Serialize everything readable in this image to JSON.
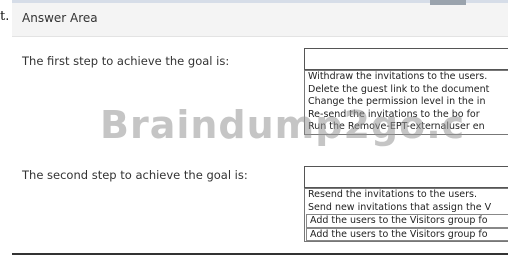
{
  "prefix_text": "t.",
  "header": {
    "title": "Answer Area"
  },
  "step1": {
    "label": "The first step to achieve the goal is:",
    "selected_value": "",
    "options": [
      "Withdraw the invitations to the users.",
      "Delete the guest link to the document",
      "Change the permission level in the in",
      "Re-send the invitations to the bo for",
      "Run the Remove-EPT-externaluser en"
    ]
  },
  "step2": {
    "label": "The second step to achieve the goal is:",
    "selected_value": "",
    "options": [
      "Resend the invitations to the users.",
      "Send new invitations that assign the V",
      "Add the users to the Visitors group fo",
      "Add the users to the Visitors group fo"
    ]
  },
  "watermark": "Braindump2go.c"
}
